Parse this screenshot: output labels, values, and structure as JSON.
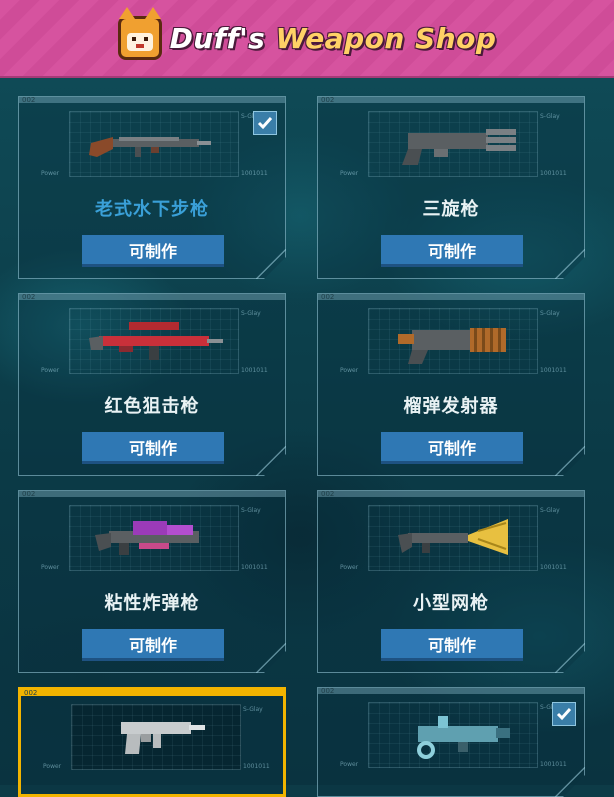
{
  "header": {
    "title_part1": "Duff's",
    "title_part2": "Weapon Shop"
  },
  "frame_labels": {
    "code": "002",
    "top_right": "S-Glay",
    "bottom_left": "Power",
    "bottom_right": "1001011"
  },
  "weapons": [
    {
      "name": "老式水下步枪",
      "button": "可制作",
      "owned": true,
      "selected": false,
      "name_color": "#3aa0d8",
      "icon": "old-underwater-rifle-icon"
    },
    {
      "name": "三旋枪",
      "button": "可制作",
      "owned": false,
      "selected": false,
      "icon": "triple-barrel-gun-icon"
    },
    {
      "name": "红色狙击枪",
      "button": "可制作",
      "owned": false,
      "selected": false,
      "icon": "red-sniper-rifle-icon"
    },
    {
      "name": "榴弹发射器",
      "button": "可制作",
      "owned": false,
      "selected": false,
      "icon": "grenade-launcher-icon"
    },
    {
      "name": "粘性炸弹枪",
      "button": "可制作",
      "owned": false,
      "selected": false,
      "icon": "sticky-bomb-gun-icon"
    },
    {
      "name": "小型网枪",
      "button": "可制作",
      "owned": false,
      "selected": false,
      "icon": "small-net-gun-icon"
    },
    {
      "name": "",
      "button": "",
      "owned": false,
      "selected": true,
      "icon": "pistol-icon"
    },
    {
      "name": "",
      "button": "",
      "owned": true,
      "selected": false,
      "icon": "blaster-icon"
    }
  ],
  "colors": {
    "header_pink": "#d6539f",
    "button_blue": "#2f78b4",
    "selected_gold": "#f2b400",
    "background_teal": "#0d3b47"
  }
}
